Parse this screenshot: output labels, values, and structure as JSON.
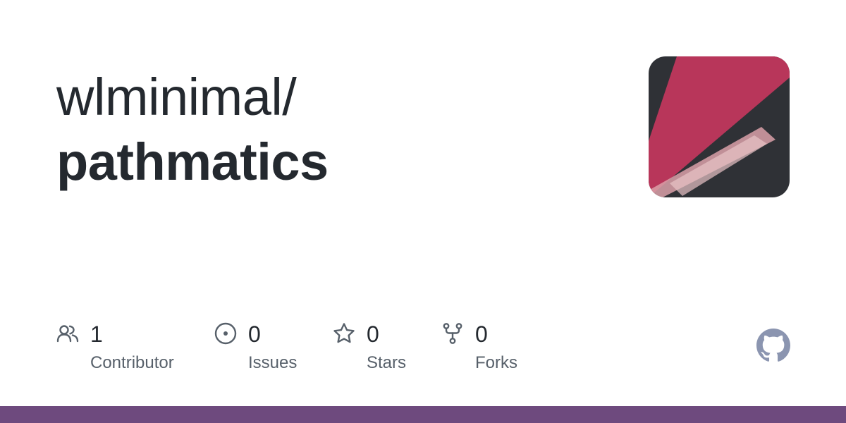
{
  "repo": {
    "owner": "wlminimal/",
    "name": "pathmatics"
  },
  "stats": [
    {
      "icon": "people-icon",
      "value": "1",
      "label": "Contributor"
    },
    {
      "icon": "issue-opened-icon",
      "value": "0",
      "label": "Issues"
    },
    {
      "icon": "star-icon",
      "value": "0",
      "label": "Stars"
    },
    {
      "icon": "repo-forked-icon",
      "value": "0",
      "label": "Forks"
    }
  ],
  "colors": {
    "text": "#24292f",
    "muted": "#57606a",
    "icon": "#57606a",
    "accent_bar": "#6e4a7e",
    "avatar_red": "#b8365a",
    "avatar_dark": "#2f3136",
    "github_logo": "#8b95b0"
  }
}
